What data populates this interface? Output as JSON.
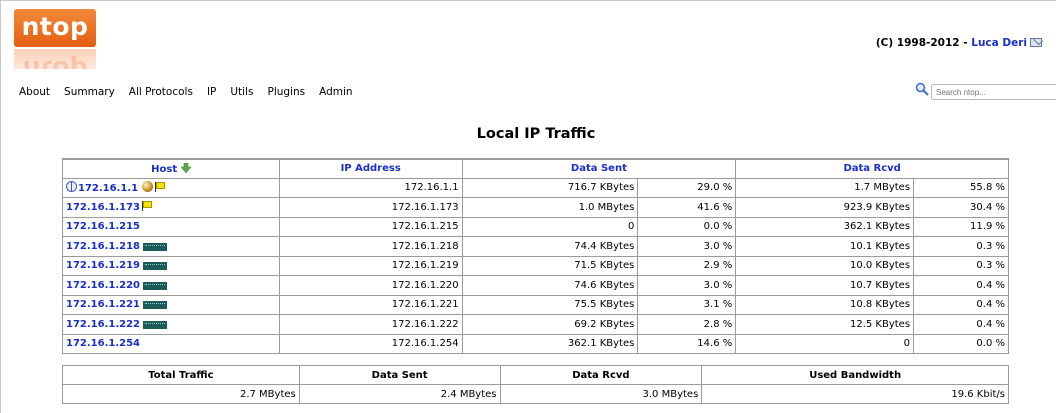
{
  "brand": {
    "logo_text": "ntop"
  },
  "header": {
    "copyright_prefix": "(C) 1998-2012 - ",
    "author_link": "Luca Deri"
  },
  "nav": {
    "items": [
      "About",
      "Summary",
      "All Protocols",
      "IP",
      "Utils",
      "Plugins",
      "Admin"
    ]
  },
  "search": {
    "placeholder": "Search ntop..."
  },
  "page": {
    "title": "Local IP Traffic"
  },
  "traffic_table": {
    "headers": {
      "host": "Host",
      "ip": "IP Address",
      "sent": "Data Sent",
      "rcvd": "Data Rcvd"
    },
    "rows": [
      {
        "host": "172.16.1.1",
        "icons": [
          "globe",
          "sphere",
          "flag"
        ],
        "ip": "172.16.1.1",
        "sent": "716.7 KBytes",
        "sent_pct": "29.0 %",
        "rcvd": "1.7 MBytes",
        "rcvd_pct": "55.8 %"
      },
      {
        "host": "172.16.1.173",
        "icons": [
          "flag"
        ],
        "ip": "172.16.1.173",
        "sent": "1.0 MBytes",
        "sent_pct": "41.6 %",
        "rcvd": "923.9 KBytes",
        "rcvd_pct": "30.4 %"
      },
      {
        "host": "172.16.1.215",
        "icons": [],
        "ip": "172.16.1.215",
        "sent": "0",
        "sent_pct": "0.0 %",
        "rcvd": "362.1 KBytes",
        "rcvd_pct": "11.9 %"
      },
      {
        "host": "172.16.1.218",
        "icons": [
          "spark"
        ],
        "ip": "172.16.1.218",
        "sent": "74.4 KBytes",
        "sent_pct": "3.0 %",
        "rcvd": "10.1 KBytes",
        "rcvd_pct": "0.3 %"
      },
      {
        "host": "172.16.1.219",
        "icons": [
          "spark"
        ],
        "ip": "172.16.1.219",
        "sent": "71.5 KBytes",
        "sent_pct": "2.9 %",
        "rcvd": "10.0 KBytes",
        "rcvd_pct": "0.3 %"
      },
      {
        "host": "172.16.1.220",
        "icons": [
          "spark"
        ],
        "ip": "172.16.1.220",
        "sent": "74.6 KBytes",
        "sent_pct": "3.0 %",
        "rcvd": "10.7 KBytes",
        "rcvd_pct": "0.4 %"
      },
      {
        "host": "172.16.1.221",
        "icons": [
          "spark"
        ],
        "ip": "172.16.1.221",
        "sent": "75.5 KBytes",
        "sent_pct": "3.1 %",
        "rcvd": "10.8 KBytes",
        "rcvd_pct": "0.4 %"
      },
      {
        "host": "172.16.1.222",
        "icons": [
          "spark"
        ],
        "ip": "172.16.1.222",
        "sent": "69.2 KBytes",
        "sent_pct": "2.8 %",
        "rcvd": "12.5 KBytes",
        "rcvd_pct": "0.4 %"
      },
      {
        "host": "172.16.1.254",
        "icons": [],
        "ip": "172.16.1.254",
        "sent": "362.1 KBytes",
        "sent_pct": "14.6 %",
        "rcvd": "0",
        "rcvd_pct": "0.0 %"
      }
    ]
  },
  "summary_table": {
    "headers": [
      "Total Traffic",
      "Data Sent",
      "Data Rcvd",
      "Used Bandwidth"
    ],
    "values": [
      "2.7 MBytes",
      "2.4 MBytes",
      "3.0 MBytes",
      "19.6 Kbit/s"
    ]
  },
  "colors": {
    "link": "#1a2fc8",
    "logo": "#ec7424",
    "border": "#9b9b9b"
  }
}
